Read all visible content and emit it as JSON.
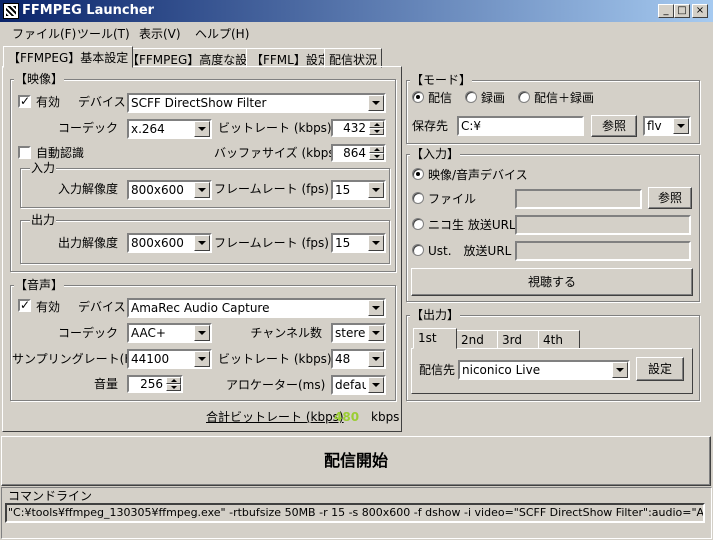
{
  "window": {
    "title": "FFMPEG Launcher",
    "minimize": "_",
    "maximize": "□",
    "close": "×"
  },
  "menu": [
    "ファイル(F)",
    "ツール(T)",
    "表示(V)",
    "ヘルプ(H)"
  ],
  "tabs": [
    "【FFMPEG】基本設定",
    "【FFMPEG】高度な設定",
    "【FFML】設定",
    "配信状況"
  ],
  "video": {
    "group_label": "【映像】",
    "enabled_label": "有効",
    "enabled_mark": "✓",
    "device_label": "デバイス",
    "device_value": "SCFF DirectShow Filter",
    "codec_label": "コーデック",
    "codec_value": "x.264",
    "bitrate_label": "ビットレート (kbps)",
    "bitrate_value": "432",
    "auto_detect_label": "自動認識",
    "buffer_label": "バッファサイズ (kbps)",
    "buffer_value": "864",
    "input": {
      "group_label": "入力",
      "resolution_label": "入力解像度",
      "resolution_value": "800x600",
      "framerate_label": "フレームレート (fps)",
      "framerate_value": "15"
    },
    "output": {
      "group_label": "出力",
      "resolution_label": "出力解像度",
      "resolution_value": "800x600",
      "framerate_label": "フレームレート (fps)",
      "framerate_value": "15"
    }
  },
  "audio": {
    "group_label": "【音声】",
    "enabled_label": "有効",
    "enabled_mark": "✓",
    "device_label": "デバイス",
    "device_value": "AmaRec Audio Capture",
    "codec_label": "コーデック",
    "codec_value": "AAC+",
    "channel_label": "チャンネル数",
    "channel_value": "stereo",
    "samplerate_label": "サンプリングレート(Hz)",
    "samplerate_value": "44100",
    "bitrate_label": "ビットレート (kbps)",
    "bitrate_value": "48",
    "volume_label": "音量",
    "volume_value": "256",
    "allocator_label": "アロケーター(ms)",
    "allocator_value": "default"
  },
  "total_bitrate": {
    "label": "合計ビットレート (kbps)",
    "value": "480",
    "unit": "kbps",
    "value_color": "#9acd32"
  },
  "mode": {
    "group_label": "【モード】",
    "options": [
      "配信",
      "録画",
      "配信＋録画"
    ],
    "save_label": "保存先",
    "save_value": "C:¥",
    "browse_label": "参照",
    "format_value": "flv"
  },
  "input_panel": {
    "group_label": "【入力】",
    "device_option": "映像/音声デバイス",
    "file_option": "ファイル",
    "file_browse": "参照",
    "nico_option": "ニコ生 放送URL",
    "ust_option": "Ust.　放送URL",
    "watch_button": "視聴する"
  },
  "output_panel": {
    "group_label": "【出力】",
    "tabs": [
      "1st",
      "2nd",
      "3rd",
      "4th"
    ],
    "dest_label": "配信先",
    "dest_value": "niconico Live",
    "settings_button": "設定"
  },
  "start_button": "配信開始",
  "command_line": {
    "label": "コマンドライン",
    "value": "\"C:¥tools¥ffmpeg_130305¥ffmpeg.exe\" -rtbufsize 50MB -r 15 -s 800x600 -f dshow -i video=\"SCFF DirectShow Filter\":audio=\"AmaRec"
  }
}
